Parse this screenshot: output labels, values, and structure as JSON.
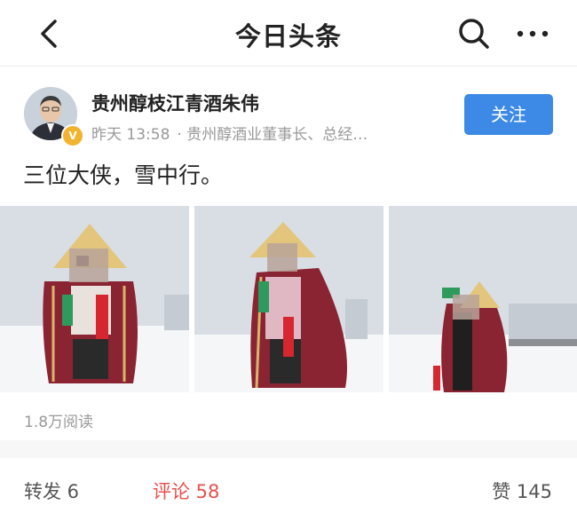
{
  "header": {
    "title": "今日头条"
  },
  "post": {
    "author": "贵州醇枝江青酒朱伟",
    "verified_badge": "V",
    "time": "昨天 13:58",
    "bio": "· 贵州醇酒业董事长、总经…",
    "follow_label": "关注",
    "text": "三位大侠，雪中行。",
    "reads": "1.8万阅读"
  },
  "actions": {
    "share": "转发 6",
    "comment": "评论 58",
    "like": "赞 145"
  },
  "colors": {
    "accent": "#3d8ae6",
    "comment": "#e6504b",
    "badge": "#f2b32f"
  }
}
